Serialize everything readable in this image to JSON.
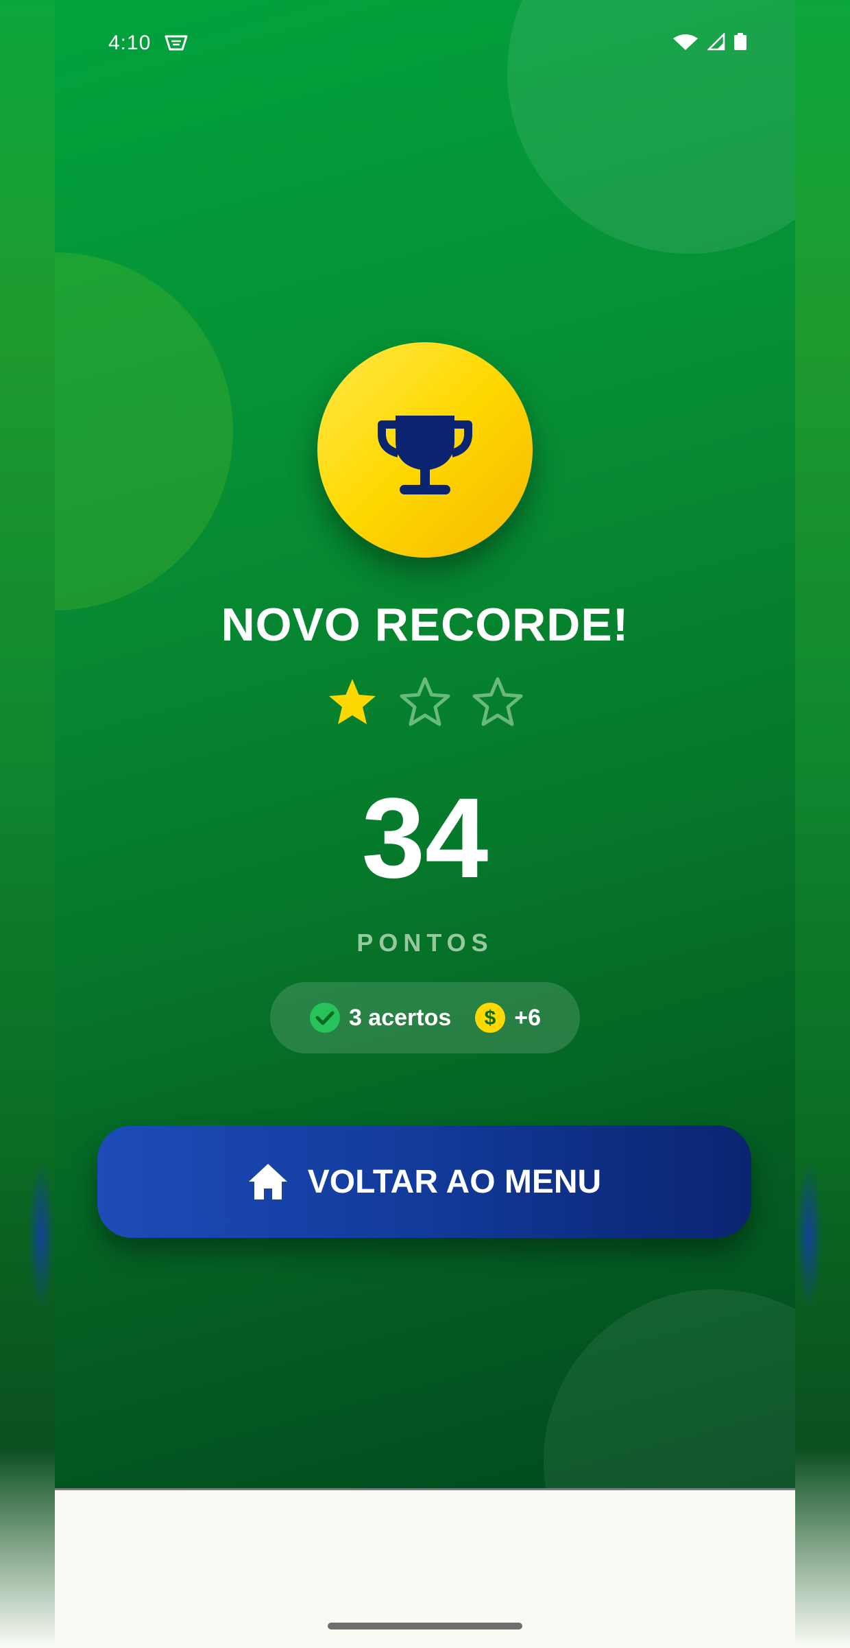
{
  "status_bar": {
    "time": "4:10",
    "icons": [
      "notification-icon",
      "wifi-icon",
      "signal-icon",
      "battery-icon"
    ]
  },
  "result": {
    "title": "NOVO RECORDE!",
    "stars": {
      "earned": 1,
      "total": 3
    },
    "score": "34",
    "score_label": "PONTOS"
  },
  "stats": {
    "correct": {
      "icon": "check-circle-icon",
      "label": "3 acertos"
    },
    "coins": {
      "icon": "coin-icon",
      "label": "+6"
    }
  },
  "menu_button": {
    "icon": "home-icon",
    "label": "VOLTAR AO MENU"
  },
  "colors": {
    "accent_yellow": "#ffd800",
    "button_blue": "#1d4cb8",
    "background_green": "#068f34"
  }
}
